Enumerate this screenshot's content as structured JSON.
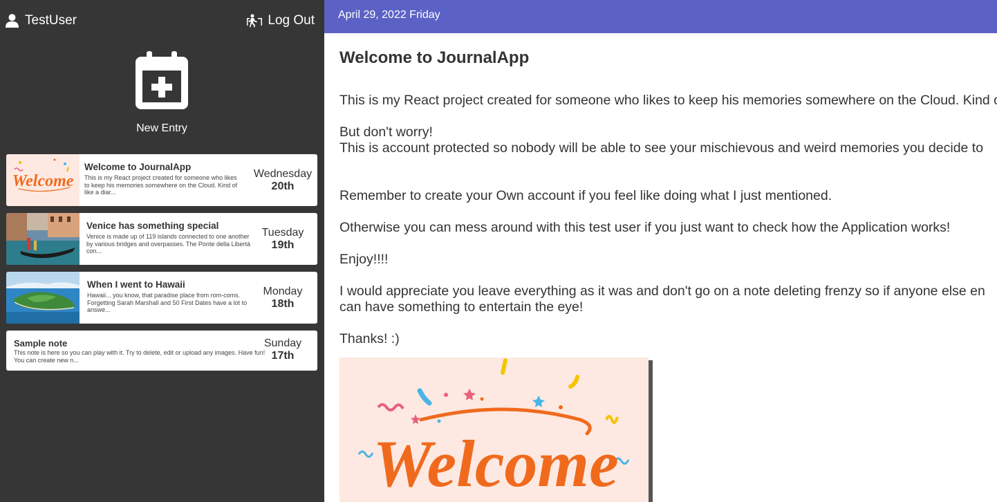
{
  "sidebar": {
    "user_name": "TestUser",
    "logout_label": "Log Out",
    "new_entry_label": "New Entry",
    "entries": [
      {
        "title": "Welcome to JournalApp",
        "text": "This is my React project created for someone who likes to keep his memories somewhere on the Cloud. Kind of like a diar...",
        "day": "Wednesday",
        "date": "20th",
        "image_word": "Welcome",
        "thumb": "welcome"
      },
      {
        "title": "Venice has something special",
        "text": "Venice is made up of 119 islands connected to one another by various bridges and overpasses. The Ponte della Libertà con...",
        "day": "Tuesday",
        "date": "19th",
        "thumb": "venice"
      },
      {
        "title": "When I went to Hawaii",
        "text": "Hawaii... you know, that paradise place from rom-coms. Forgetting Sarah Marshall and 50 First Dates have a lot to answe...",
        "day": "Monday",
        "date": "18th",
        "thumb": "hawaii"
      },
      {
        "title": "Sample note",
        "text": "This note is here so you can play with it. Try to delete, edit or upload any images. Have fun! You can create new n...",
        "day": "Sunday",
        "date": "17th",
        "thumb": null
      }
    ]
  },
  "main": {
    "date": "April 29, 2022 Friday",
    "title": "Welcome to JournalApp",
    "paragraphs": [
      "This is my React project created for someone who likes to keep his memories somewhere on the Cloud. Kind of like a diary",
      "",
      "But don't worry!",
      "This is account protected so nobody will be able to see your mischievous and weird memories you decide to",
      "",
      "",
      "Remember to create your Own account if you feel like doing what I just mentioned.",
      "",
      "Otherwise you can mess around with this test user if you just want to check how the Application works!",
      "",
      "Enjoy!!!!",
      "",
      "I would appreciate you leave everything as it was and don't go on a note deleting frenzy so if anyone else en",
      "can have something to entertain the eye!",
      "",
      "Thanks! :)"
    ],
    "image_word": "Welcome"
  },
  "colors": {
    "sidebar_bg": "#363636",
    "topbar_bg": "#5c62c5",
    "welcome_orange": "#f06a1e",
    "welcome_bg": "#fde9e1"
  },
  "icons": {
    "user": "user-icon",
    "logout": "logout-icon",
    "new_entry": "calendar-plus-icon"
  }
}
